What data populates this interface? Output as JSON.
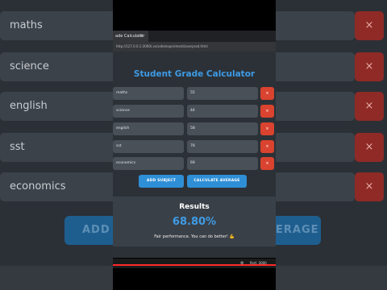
{
  "tab": {
    "title": "ade Calculator",
    "close": "✕"
  },
  "address": "http://127.0.0.1:3000/.vscode/experiment/averprod.html",
  "app": {
    "title": "Student Grade Calculator",
    "rows": [
      {
        "subject": "maths",
        "score": "55",
        "delete": "×"
      },
      {
        "subject": "science",
        "score": "44",
        "delete": "×"
      },
      {
        "subject": "english",
        "score": "58",
        "delete": "×"
      },
      {
        "subject": "sst",
        "score": "78",
        "delete": "×"
      },
      {
        "subject": "economics",
        "score": "69",
        "delete": "×"
      }
    ],
    "add_subject_label": "ADD SUBJECT",
    "calculate_label": "CALCULATE AVERAGE",
    "results": {
      "title": "Results",
      "value": "68.80%",
      "message": "Fair performance. You can do better! 💪"
    }
  },
  "background": {
    "rows": [
      {
        "subject": "maths",
        "delete": "×"
      },
      {
        "subject": "science",
        "delete": "×"
      },
      {
        "subject": "english",
        "delete": "×"
      },
      {
        "subject": "sst",
        "delete": "×"
      },
      {
        "subject": "economics",
        "delete": "×"
      }
    ],
    "add_btn_label": "ADD S",
    "avg_btn_label": "ERAGE"
  },
  "status": {
    "icon": "gear-icon",
    "text": "Port: 3000"
  },
  "video_progress": 1.0,
  "colors": {
    "accent": "#3e9be6",
    "danger": "#d9432f",
    "button": "#2f8fd6"
  }
}
